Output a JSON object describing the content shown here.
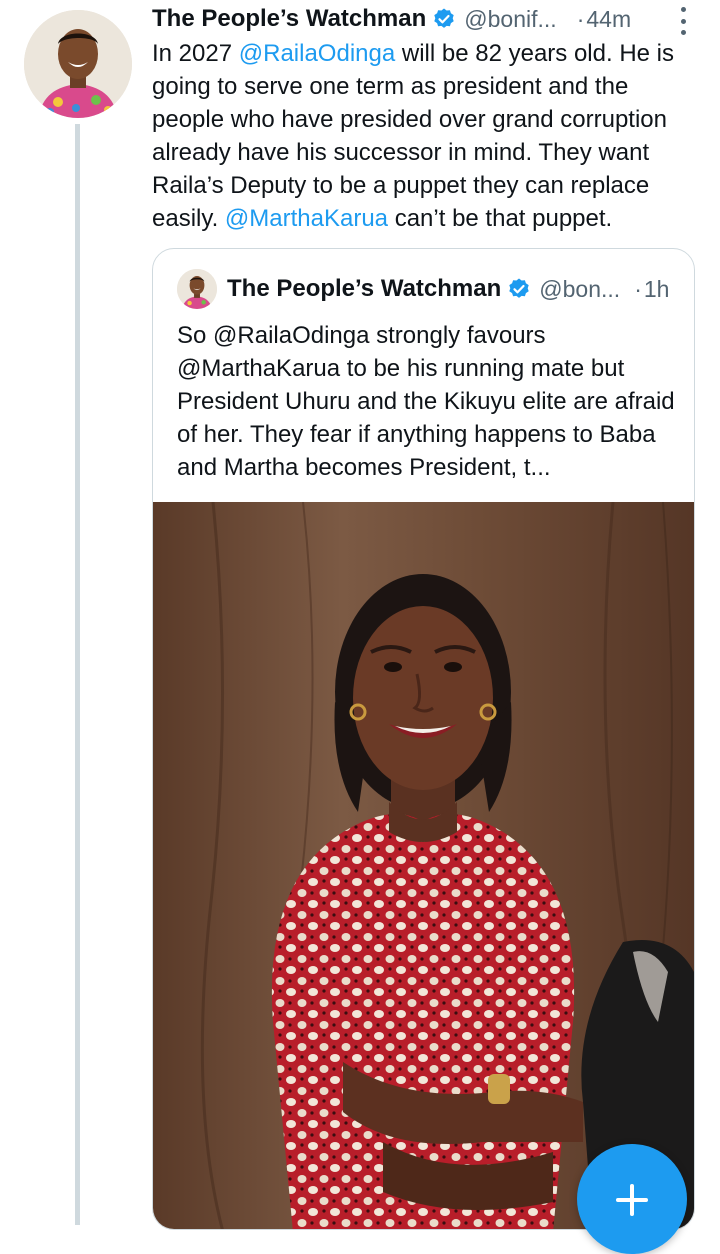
{
  "tweet": {
    "author_name": "The People’s Watchman",
    "handle": "@bonif...",
    "separator": "·",
    "time": "44m",
    "text_parts": [
      "In 2027 ",
      "@RailaOdinga",
      " will be 82 years old. He is going to serve one term as president and the people who have presided over grand corruption already have his successor in mind. They want Raila’s Deputy to be a puppet they can replace easily.  ",
      "@MarthaKarua",
      " can’t be that puppet."
    ]
  },
  "quoted_tweet": {
    "author_name": "The People’s Watchman",
    "handle": "@bon...",
    "separator": "·",
    "time": "1h",
    "text": "So @RailaOdinga strongly favours @MarthaKarua to be his running mate but President Uhuru and the Kikuyu elite are afraid of her. They fear if anything happens to Baba and Martha becomes President, t..."
  },
  "icons": {
    "verified": "verified-badge-icon",
    "more": "more-vertical-icon",
    "compose": "plus-icon"
  },
  "colors": {
    "accent": "#1d9bf0",
    "text": "#0f1419",
    "secondary": "#536471",
    "border": "#cfd9de"
  }
}
